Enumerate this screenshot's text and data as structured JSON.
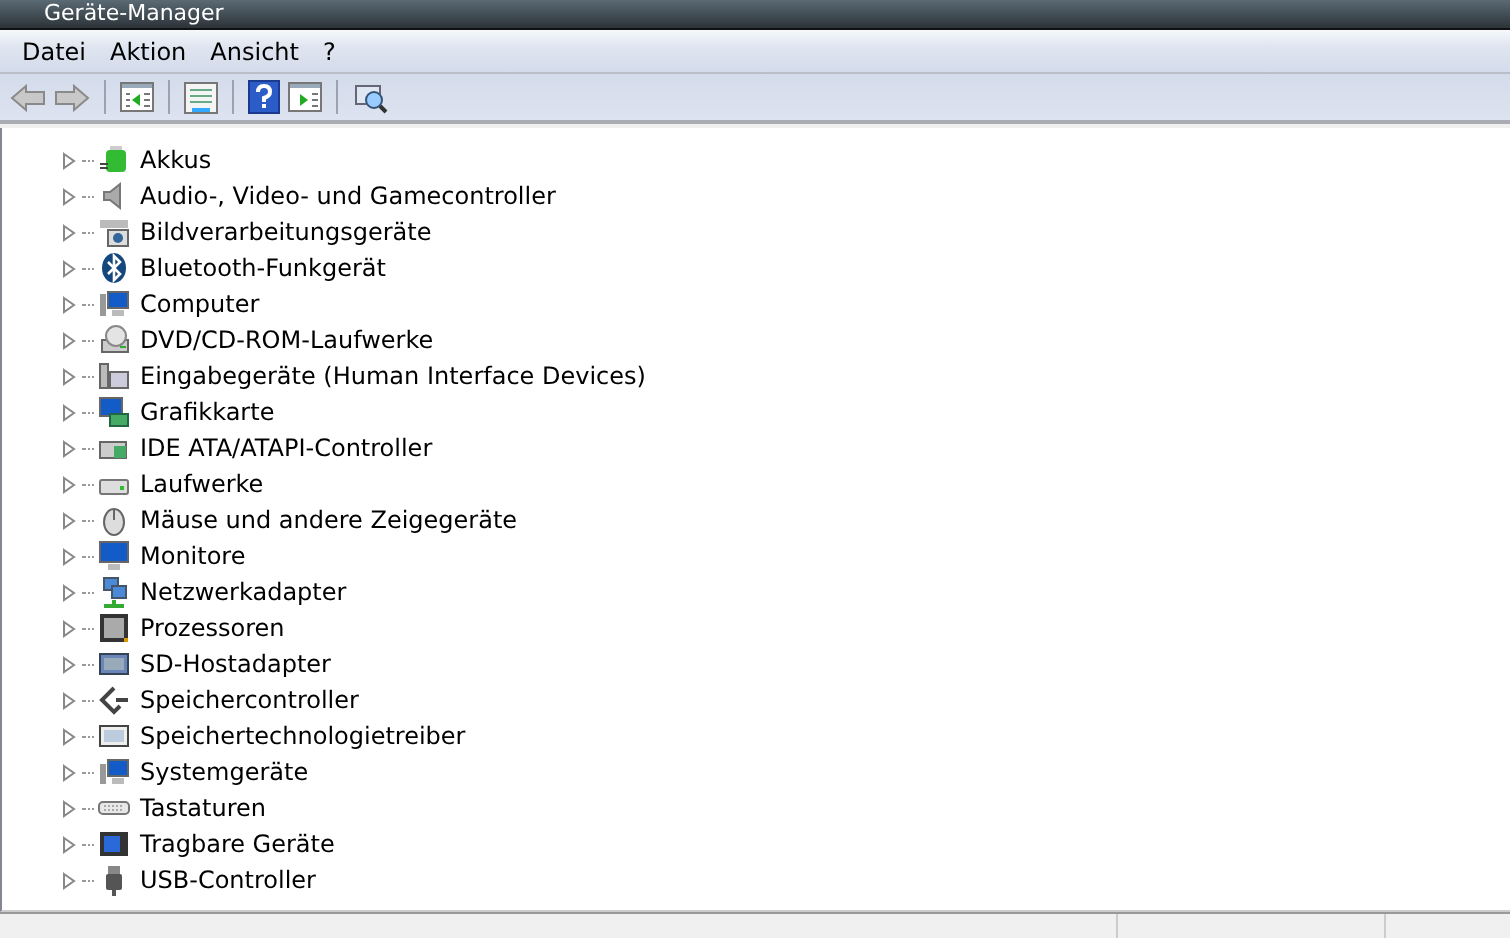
{
  "window": {
    "title": "Geräte-Manager"
  },
  "menu": [
    "Datei",
    "Aktion",
    "Ansicht",
    "?"
  ],
  "tree": [
    {
      "label": "Akkus",
      "expanded": false
    },
    {
      "label": "Audio-, Video- und Gamecontroller",
      "expanded": false
    },
    {
      "label": "Bildverarbeitungsgeräte",
      "expanded": false
    },
    {
      "label": "Bluetooth-Funkgerät",
      "expanded": false
    },
    {
      "label": "Computer",
      "expanded": false
    },
    {
      "label": "DVD/CD-ROM-Laufwerke",
      "expanded": false
    },
    {
      "label": "Eingabegeräte (Human Interface Devices)",
      "expanded": false
    },
    {
      "label": "Grafikkarte",
      "expanded": false
    },
    {
      "label": "IDE ATA/ATAPI-Controller",
      "expanded": false
    },
    {
      "label": "Laufwerke",
      "expanded": false
    },
    {
      "label": "Mäuse und andere Zeigegeräte",
      "expanded": false
    },
    {
      "label": "Monitore",
      "expanded": false
    },
    {
      "label": "Netzwerkadapter",
      "expanded": false
    },
    {
      "label": "Prozessoren",
      "expanded": false
    },
    {
      "label": "SD-Hostadapter",
      "expanded": false
    },
    {
      "label": "Speichercontroller",
      "expanded": false
    },
    {
      "label": "Speichertechnologietreiber",
      "expanded": false
    },
    {
      "label": "Systemgeräte",
      "expanded": false
    },
    {
      "label": "Tastaturen",
      "expanded": false
    },
    {
      "label": "Tragbare Geräte",
      "expanded": false
    },
    {
      "label": "USB-Controller",
      "expanded": false
    }
  ]
}
